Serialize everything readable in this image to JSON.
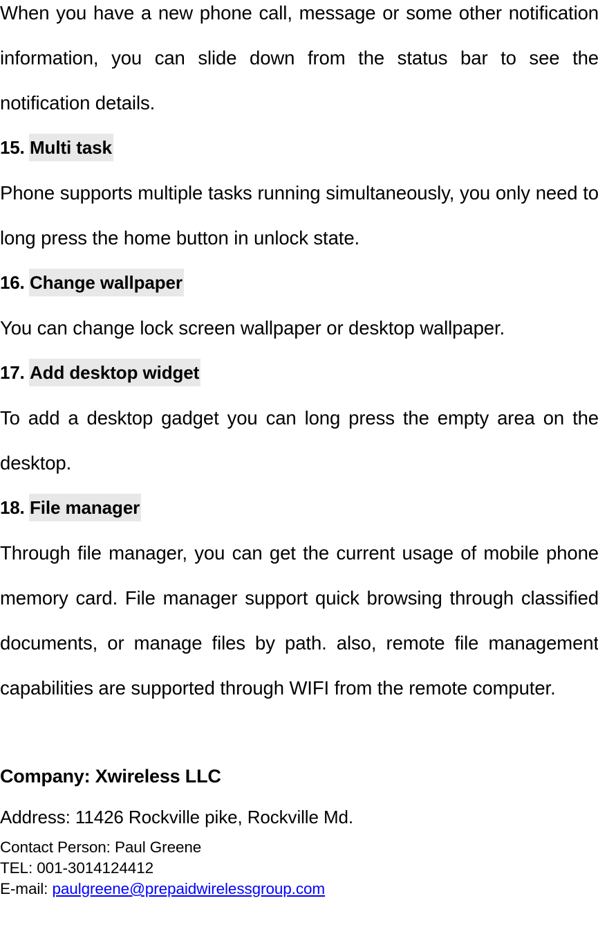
{
  "document": {
    "intro_paragraph": "When you have a new phone call, message or some other notification information, you can slide down from the status bar to see the notification details.",
    "sections": [
      {
        "number": "15.",
        "title": "Multi task",
        "body": "Phone supports multiple tasks running simultaneously, you only need to long press the home button in unlock state."
      },
      {
        "number": "16.",
        "title": "Change wallpaper",
        "body": "You can change lock screen wallpaper or desktop wallpaper."
      },
      {
        "number": "17.",
        "title": "Add desktop widget",
        "body": "To add a desktop gadget you can long press the empty area on the desktop."
      },
      {
        "number": "18.",
        "title": "File manager",
        "body": "Through file manager, you can get the current usage of mobile phone memory card. File manager support quick browsing through classified documents, or manage files by path. also, remote file management capabilities are supported through WIFI from the remote computer."
      }
    ],
    "footer": {
      "company": "Company: Xwireless LLC",
      "address": "Address: 11426 Rockville pike, Rockville Md.",
      "contact_person": "Contact Person: Paul Greene",
      "telephone": "TEL: 001-3014124412",
      "email_label": "E-mail:",
      "email_address": "paulgreene@prepaidwirelessgroup.com"
    }
  },
  "colors": {
    "heading_highlight": "#e8e8e8",
    "link": "#0000ff",
    "text": "#000000",
    "page_background": "#ffffff"
  }
}
